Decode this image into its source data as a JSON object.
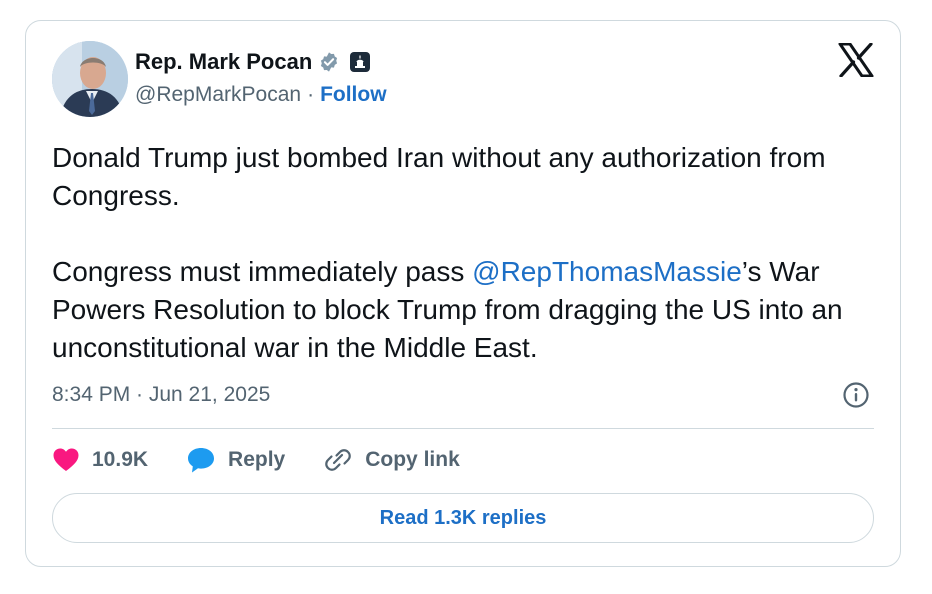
{
  "author": {
    "name": "Rep. Mark Pocan",
    "handle": "@RepMarkPocan",
    "separator": "·",
    "follow_label": "Follow"
  },
  "tweet": {
    "paragraph1": "Donald Trump just bombed Iran without any authorization from Congress.",
    "p2_before": "Congress must immediately pass ",
    "p2_mention": "@RepThomasMassie",
    "p2_after": "’s War Powers Resolution to block Trump from dragging the US into an unconstitutional war in the Middle East."
  },
  "timestamp": "8:34 PM · Jun 21, 2025",
  "actions": {
    "likes_count": "10.9K",
    "reply_label": "Reply",
    "copy_link_label": "Copy link"
  },
  "read_replies_label": "Read 1.3K replies",
  "icons": {
    "verified": "verified-badge-icon",
    "government": "government-badge-icon",
    "platform": "x-logo-icon",
    "info": "info-icon",
    "like": "heart-icon",
    "reply": "speech-bubble-icon",
    "copy": "link-icon"
  },
  "colors": {
    "link_blue": "#1d6fc6",
    "heart_pink": "#f91880",
    "reply_blue": "#1d9bf0",
    "secondary_text": "#536471",
    "border": "#cfd9de"
  }
}
